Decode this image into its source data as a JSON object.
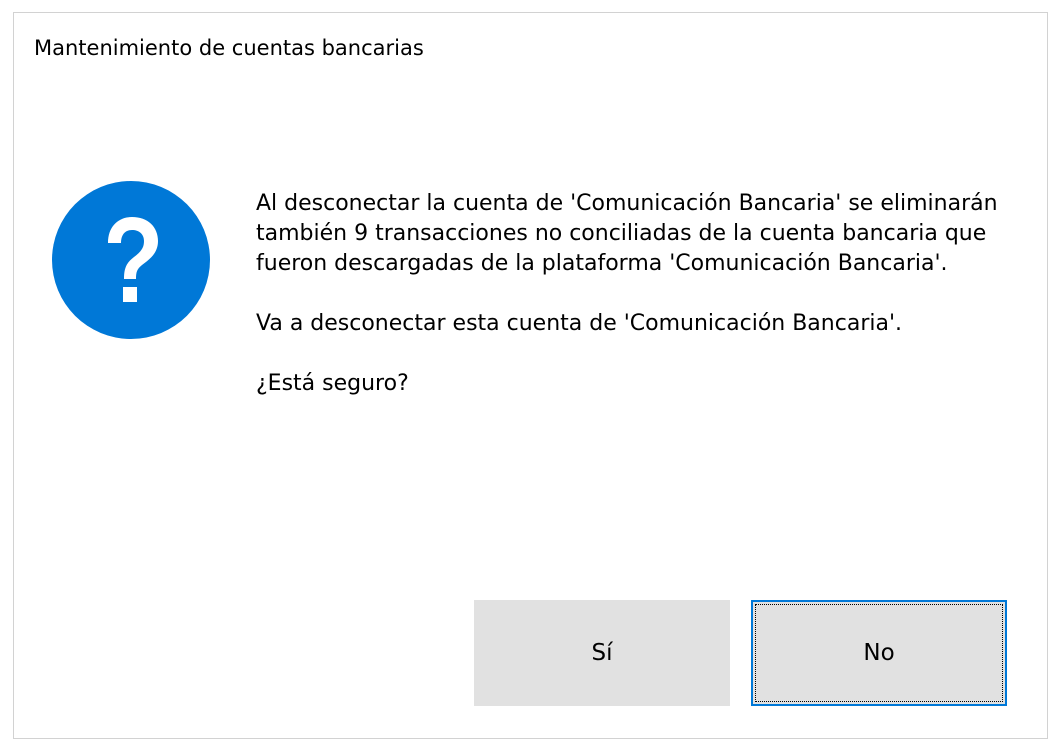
{
  "dialog": {
    "title": "Mantenimiento de cuentas bancarias",
    "icon": "question-icon",
    "icon_color": "#0078d7",
    "message": {
      "paragraph_1": "Al desconectar la cuenta de 'Comunicación Bancaria' se eliminarán también 9 transacciones no conciliadas de la cuenta bancaria que fueron descargadas de la plataforma 'Comunicación Bancaria'.",
      "paragraph_2": "Va a desconectar esta cuenta de 'Comunicación Bancaria'.",
      "paragraph_3": "¿Está seguro?"
    },
    "buttons": {
      "yes_label": "Sí",
      "no_label": "No",
      "focused": "No"
    }
  }
}
